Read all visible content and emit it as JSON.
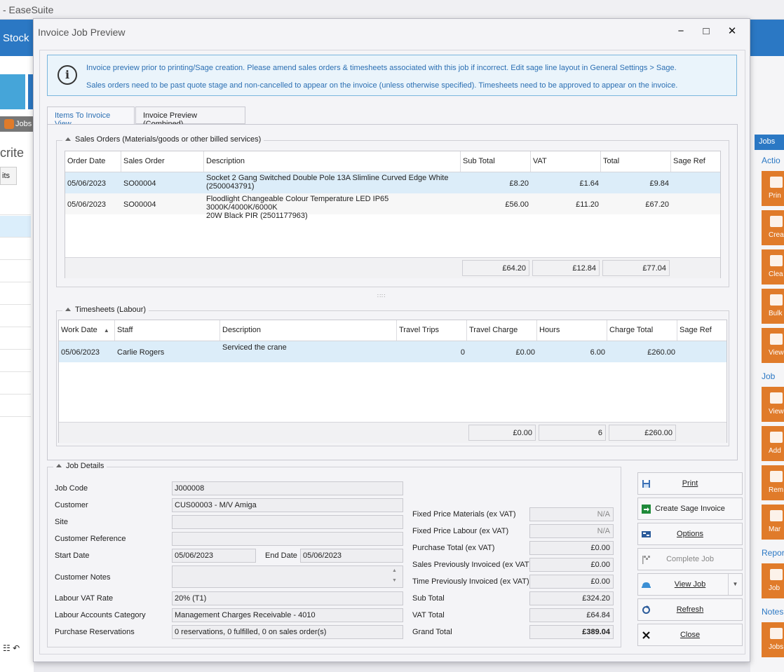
{
  "app": {
    "title": "- EaseSuite",
    "ribbon_stock": "Stock",
    "jobs_tab": "Jobs",
    "criteria_fragment": "crite",
    "its_fragment": "its",
    "right_panel": {
      "jobs_header": "Jobs",
      "groups": [
        "Actio",
        "Job",
        "Repor",
        "Notes"
      ],
      "buttons": [
        "Prin",
        "Crea",
        "Clea",
        "Bulk",
        "View",
        "View",
        "Add",
        "Rem",
        "Mar",
        "Job",
        "Jobs"
      ]
    }
  },
  "dialog": {
    "title": "Invoice Job Preview",
    "controls": {
      "minimize": "−",
      "maximize": "□",
      "close": "✕"
    },
    "info": {
      "line1": "Invoice preview prior to printing/Sage creation. Please amend sales orders & timesheets associated with this job if incorrect. Edit sage line layout in General Settings > Sage.",
      "line2": "Sales orders need to be past quote stage and non-cancelled to appear on the invoice (unless otherwise specified). Timesheets need to be approved to appear on the invoice."
    },
    "tabs": [
      {
        "label": "Items To Invoice View"
      },
      {
        "label": "Invoice Preview (Combined)"
      }
    ],
    "sales_orders": {
      "group_title": "Sales Orders (Materials/goods or other billed services)",
      "columns": [
        "Order Date",
        "Sales Order",
        "Description",
        "Sub Total",
        "VAT",
        "Total",
        "Sage Ref"
      ],
      "rows": [
        {
          "date": "05/06/2023",
          "order": "SO00004",
          "desc1": "Socket 2 Gang Switched Double Pole 13A Slimline Curved Edge White",
          "desc2": "(2500043791)",
          "sub": "£8.20",
          "vat": "£1.64",
          "total": "£9.84",
          "sage": ""
        },
        {
          "date": "05/06/2023",
          "order": "SO00004",
          "desc1": "Floodlight Changeable Colour Temperature LED IP65 3000K/4000K/6000K",
          "desc2": "20W Black PIR (2501177963)",
          "sub": "£56.00",
          "vat": "£11.20",
          "total": "£67.20",
          "sage": ""
        }
      ],
      "totals": {
        "sub": "£64.20",
        "vat": "£12.84",
        "total": "£77.04"
      }
    },
    "timesheets": {
      "group_title": "Timesheets (Labour)",
      "columns": [
        "Work Date",
        "Staff",
        "Description",
        "Travel Trips",
        "Travel Charge",
        "Hours",
        "Charge Total",
        "Sage Ref"
      ],
      "rows": [
        {
          "date": "05/06/2023",
          "staff": "Carlie Rogers",
          "desc": "Serviced the crane",
          "trips": "0",
          "travel": "£0.00",
          "hours": "6.00",
          "charge": "£260.00",
          "sage": ""
        }
      ],
      "totals": {
        "travel": "£0.00",
        "hours": "6",
        "charge": "£260.00"
      }
    },
    "job_details": {
      "group_title": "Job Details",
      "job_code_label": "Job Code",
      "job_code": "J000008",
      "customer_label": "Customer",
      "customer": "CUS00003 - M/V Amiga",
      "site_label": "Site",
      "site": "",
      "customer_ref_label": "Customer Reference",
      "customer_ref": "",
      "start_date_label": "Start Date",
      "start_date": "05/06/2023",
      "end_date_label": "End Date",
      "end_date": "05/06/2023",
      "customer_notes_label": "Customer Notes",
      "customer_notes": "",
      "labour_vat_label": "Labour VAT Rate",
      "labour_vat": "20% (T1)",
      "labour_accounts_label": "Labour Accounts Category",
      "labour_accounts": "Management Charges Receivable - 4010",
      "purchase_res_label": "Purchase Reservations",
      "purchase_res": "0 reservations, 0 fulfilled, 0 on sales order(s)",
      "fixed_materials_label": "Fixed Price Materials (ex VAT)",
      "fixed_materials": "N/A",
      "fixed_labour_label": "Fixed Price Labour (ex VAT)",
      "fixed_labour": "N/A",
      "purchase_total_label": "Purchase Total (ex VAT)",
      "purchase_total": "£0.00",
      "sales_prev_label": "Sales Previously Invoiced (ex VAT)",
      "sales_prev": "£0.00",
      "time_prev_label": "Time Previously Invoiced (ex VAT)",
      "time_prev": "£0.00",
      "sub_total_label": "Sub Total",
      "sub_total": "£324.20",
      "vat_total_label": "VAT Total",
      "vat_total": "£64.84",
      "grand_total_label": "Grand Total",
      "grand_total": "£389.04"
    },
    "actions": {
      "print": "Print",
      "create_sage": "Create Sage Invoice",
      "options": "Options",
      "complete_job": "Complete Job",
      "view_job": "View Job",
      "refresh": "Refresh",
      "close": "Close"
    }
  }
}
